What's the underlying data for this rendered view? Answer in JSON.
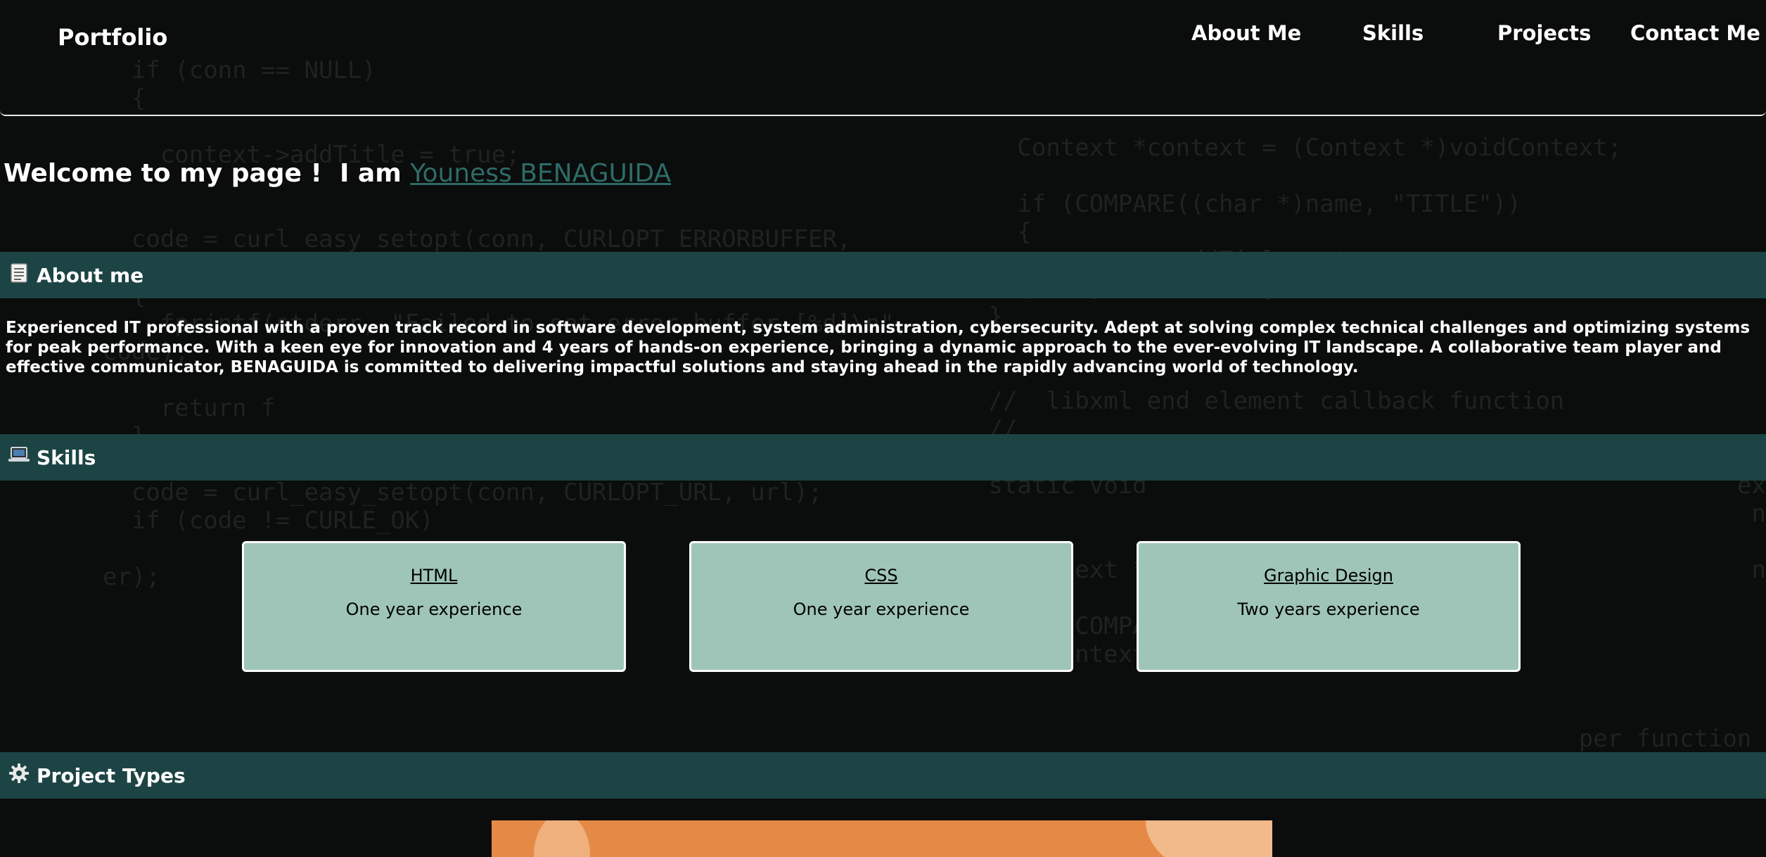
{
  "header": {
    "brand": "Portfolio",
    "nav": [
      "About Me",
      "Skills",
      "Projects",
      "Contact Me"
    ]
  },
  "welcome": {
    "prefix": "Welcome to my page !  I am ",
    "name": "Youness BENAGUIDA"
  },
  "about": {
    "heading": "About me",
    "icon": "document-icon",
    "text": "Experienced IT professional with a proven track record in software development, system administration, cybersecurity. Adept at solving complex technical challenges and optimizing systems for peak performance. With a keen eye for innovation and 4 years of hands-on experience, bringing a dynamic approach to the ever-evolving IT landscape. A collaborative team player and effective communicator, BENAGUIDA is committed to delivering impactful solutions and staying ahead in the rapidly advancing world of technology."
  },
  "skills": {
    "heading": "Skills",
    "icon": "laptop-icon",
    "cards": [
      {
        "title": "HTML",
        "experience": "One year experience"
      },
      {
        "title": "CSS",
        "experience": "One year experience"
      },
      {
        "title": "Graphic Design",
        "experience": "Two years experience"
      }
    ]
  },
  "projects": {
    "heading": "Project Types",
    "icon": "gear-icon"
  },
  "colors": {
    "background": "#0b0c0c",
    "section_bar": "#1d4444",
    "name_link": "#2e6b67",
    "card": "#9fc5b8",
    "project_image": "#e58a46"
  }
}
